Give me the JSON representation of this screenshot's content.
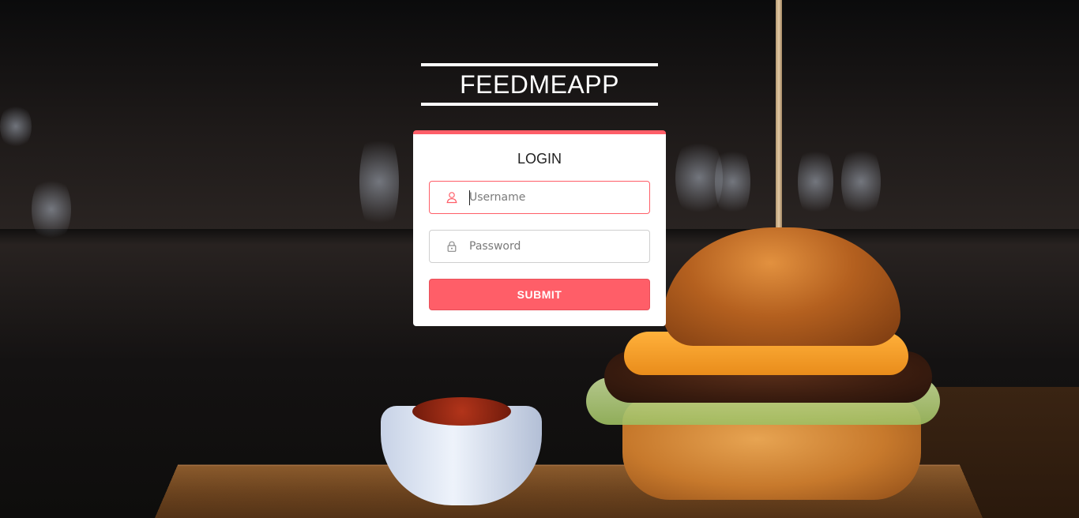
{
  "app": {
    "logo_text": "FEEDMEAPP"
  },
  "login": {
    "title": "LOGIN",
    "username": {
      "placeholder": "Username",
      "value": "",
      "icon": "user-icon"
    },
    "password": {
      "placeholder": "Password",
      "value": "",
      "icon": "lock-icon"
    },
    "submit_label": "SUBMIT"
  },
  "colors": {
    "accent": "#ff5e68",
    "card_background": "#ffffff",
    "logo_text": "#ffffff"
  }
}
